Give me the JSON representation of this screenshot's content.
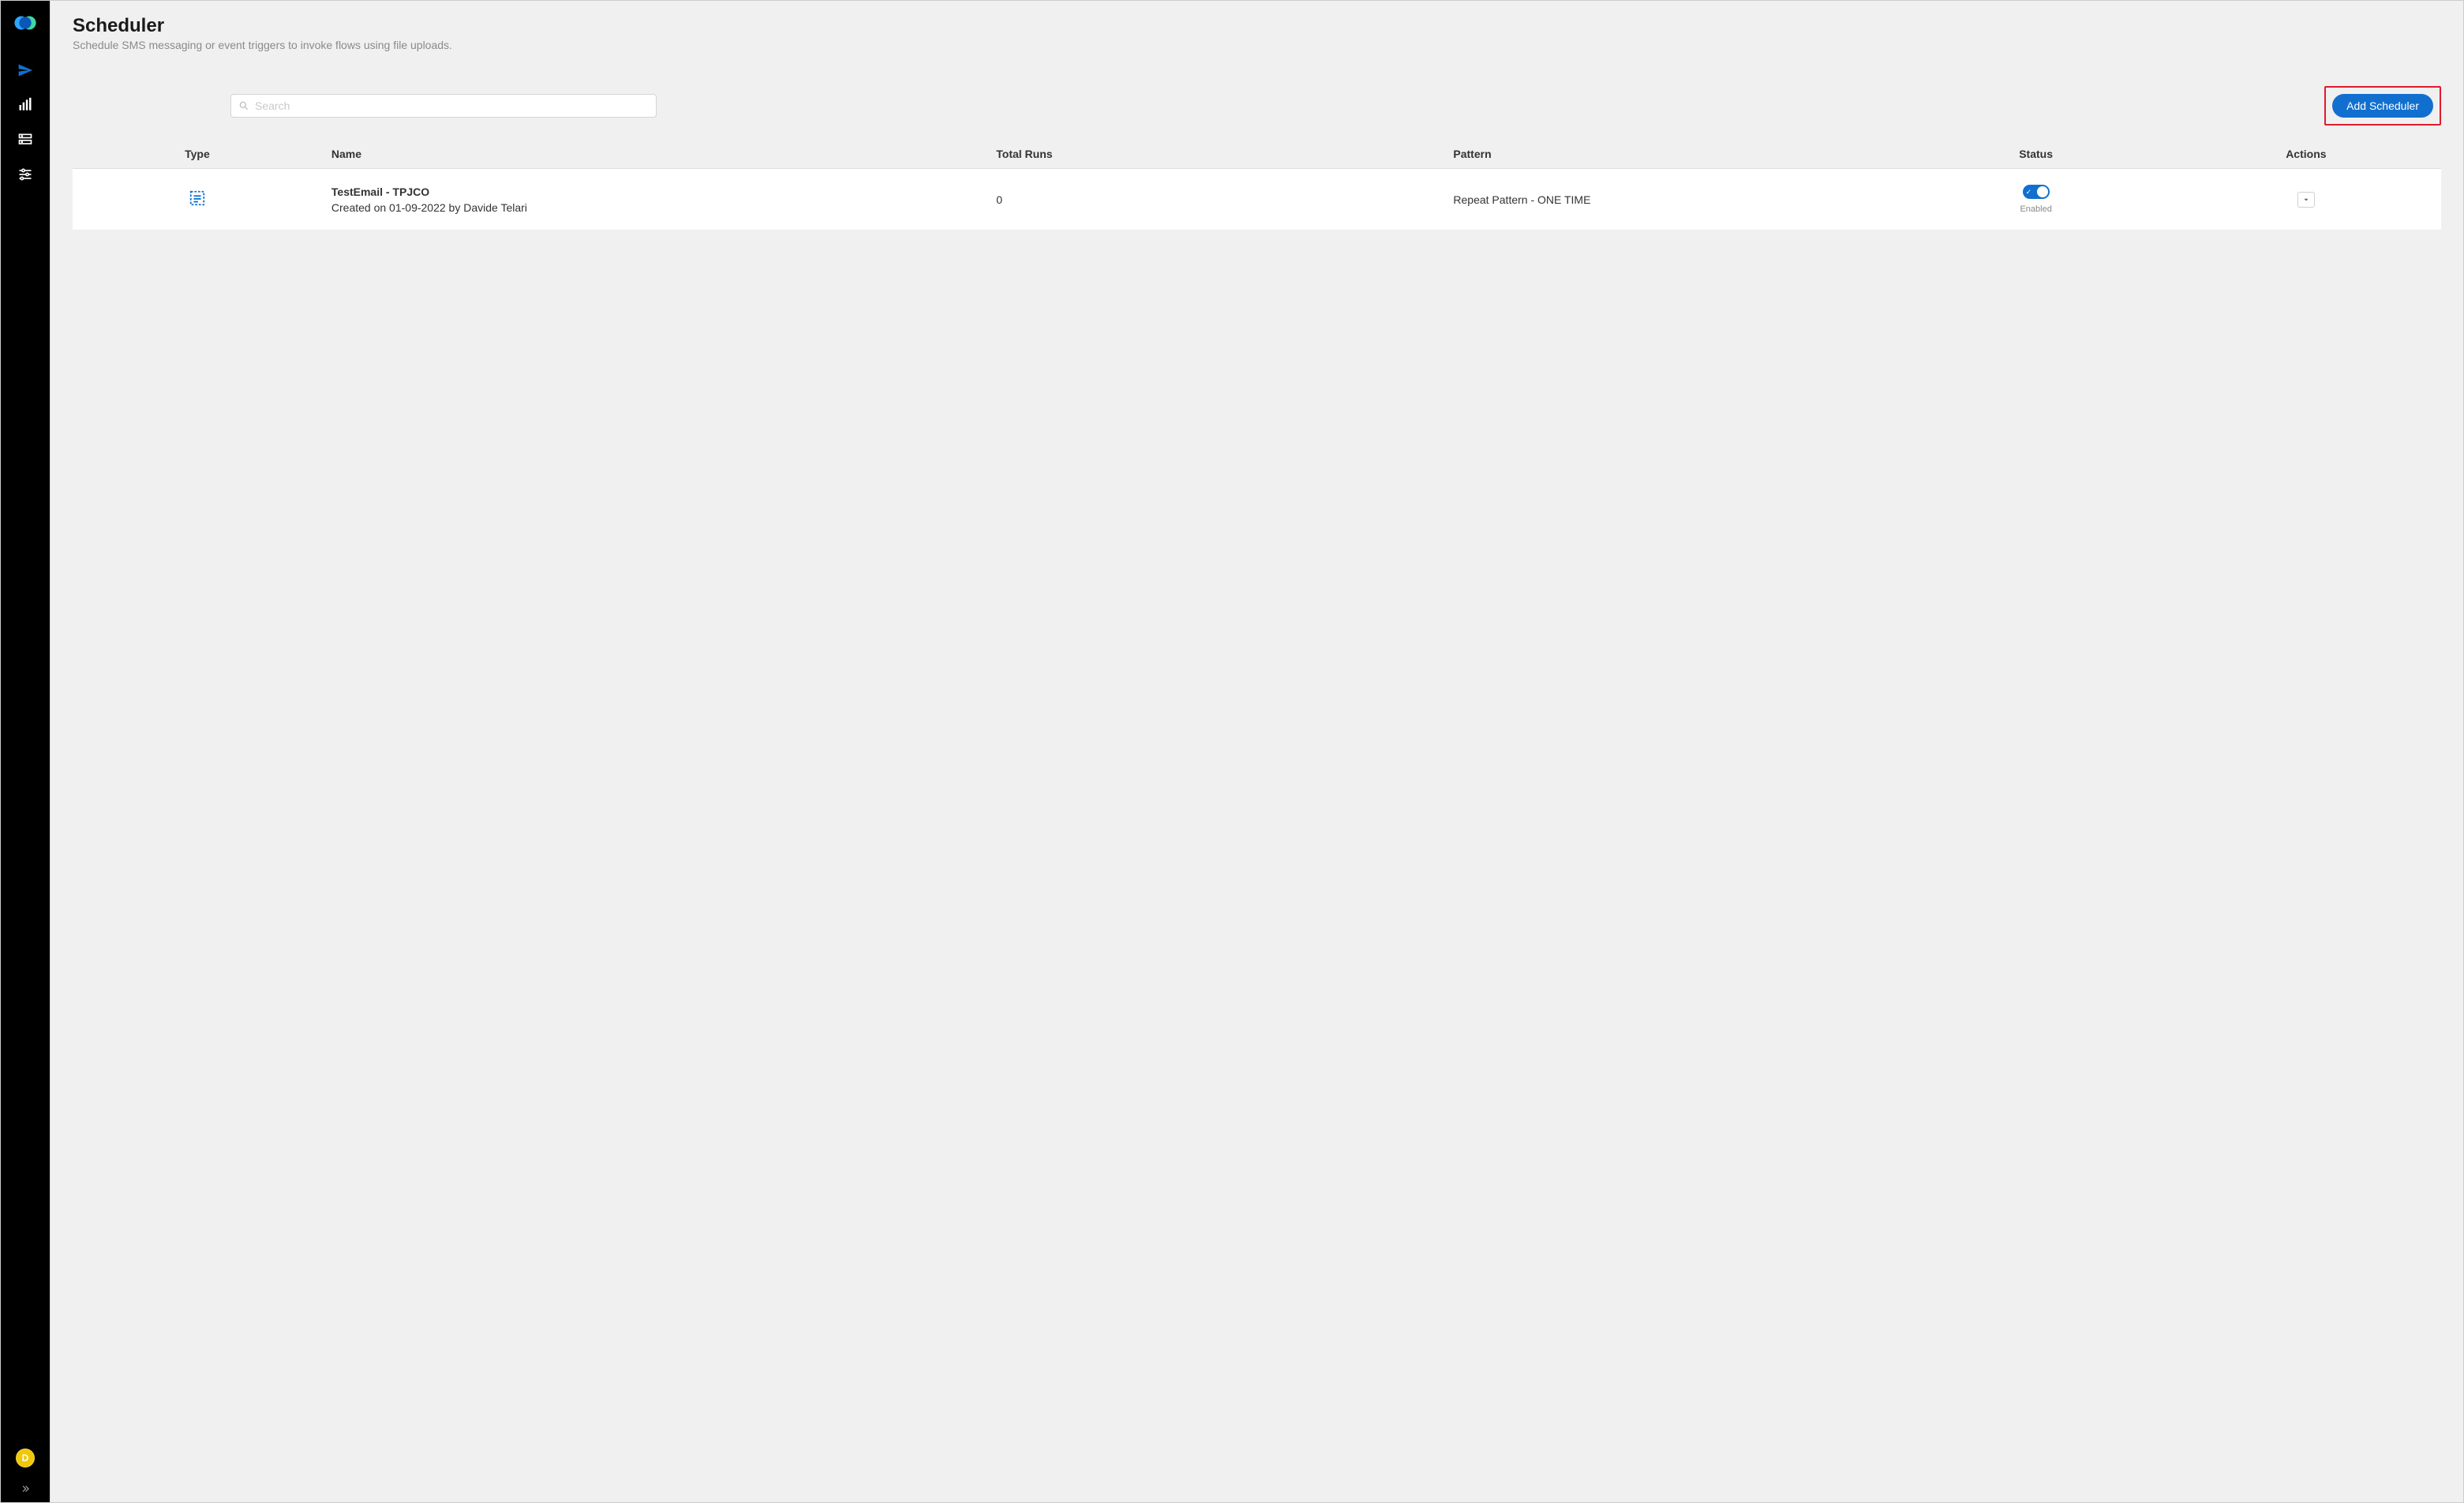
{
  "sidebar": {
    "avatar_initial": "D"
  },
  "header": {
    "title": "Scheduler",
    "subtitle": "Schedule SMS messaging or event triggers to invoke flows using file uploads."
  },
  "toolbar": {
    "search_placeholder": "Search",
    "add_button_label": "Add Scheduler"
  },
  "table": {
    "columns": {
      "type": "Type",
      "name": "Name",
      "total_runs": "Total Runs",
      "pattern": "Pattern",
      "status": "Status",
      "actions": "Actions"
    },
    "rows": [
      {
        "name": "TestEmail - TPJCO",
        "created": "Created on 01-09-2022 by Davide Telari",
        "total_runs": "0",
        "pattern": "Repeat Pattern - ONE TIME",
        "status_label": "Enabled"
      }
    ]
  }
}
